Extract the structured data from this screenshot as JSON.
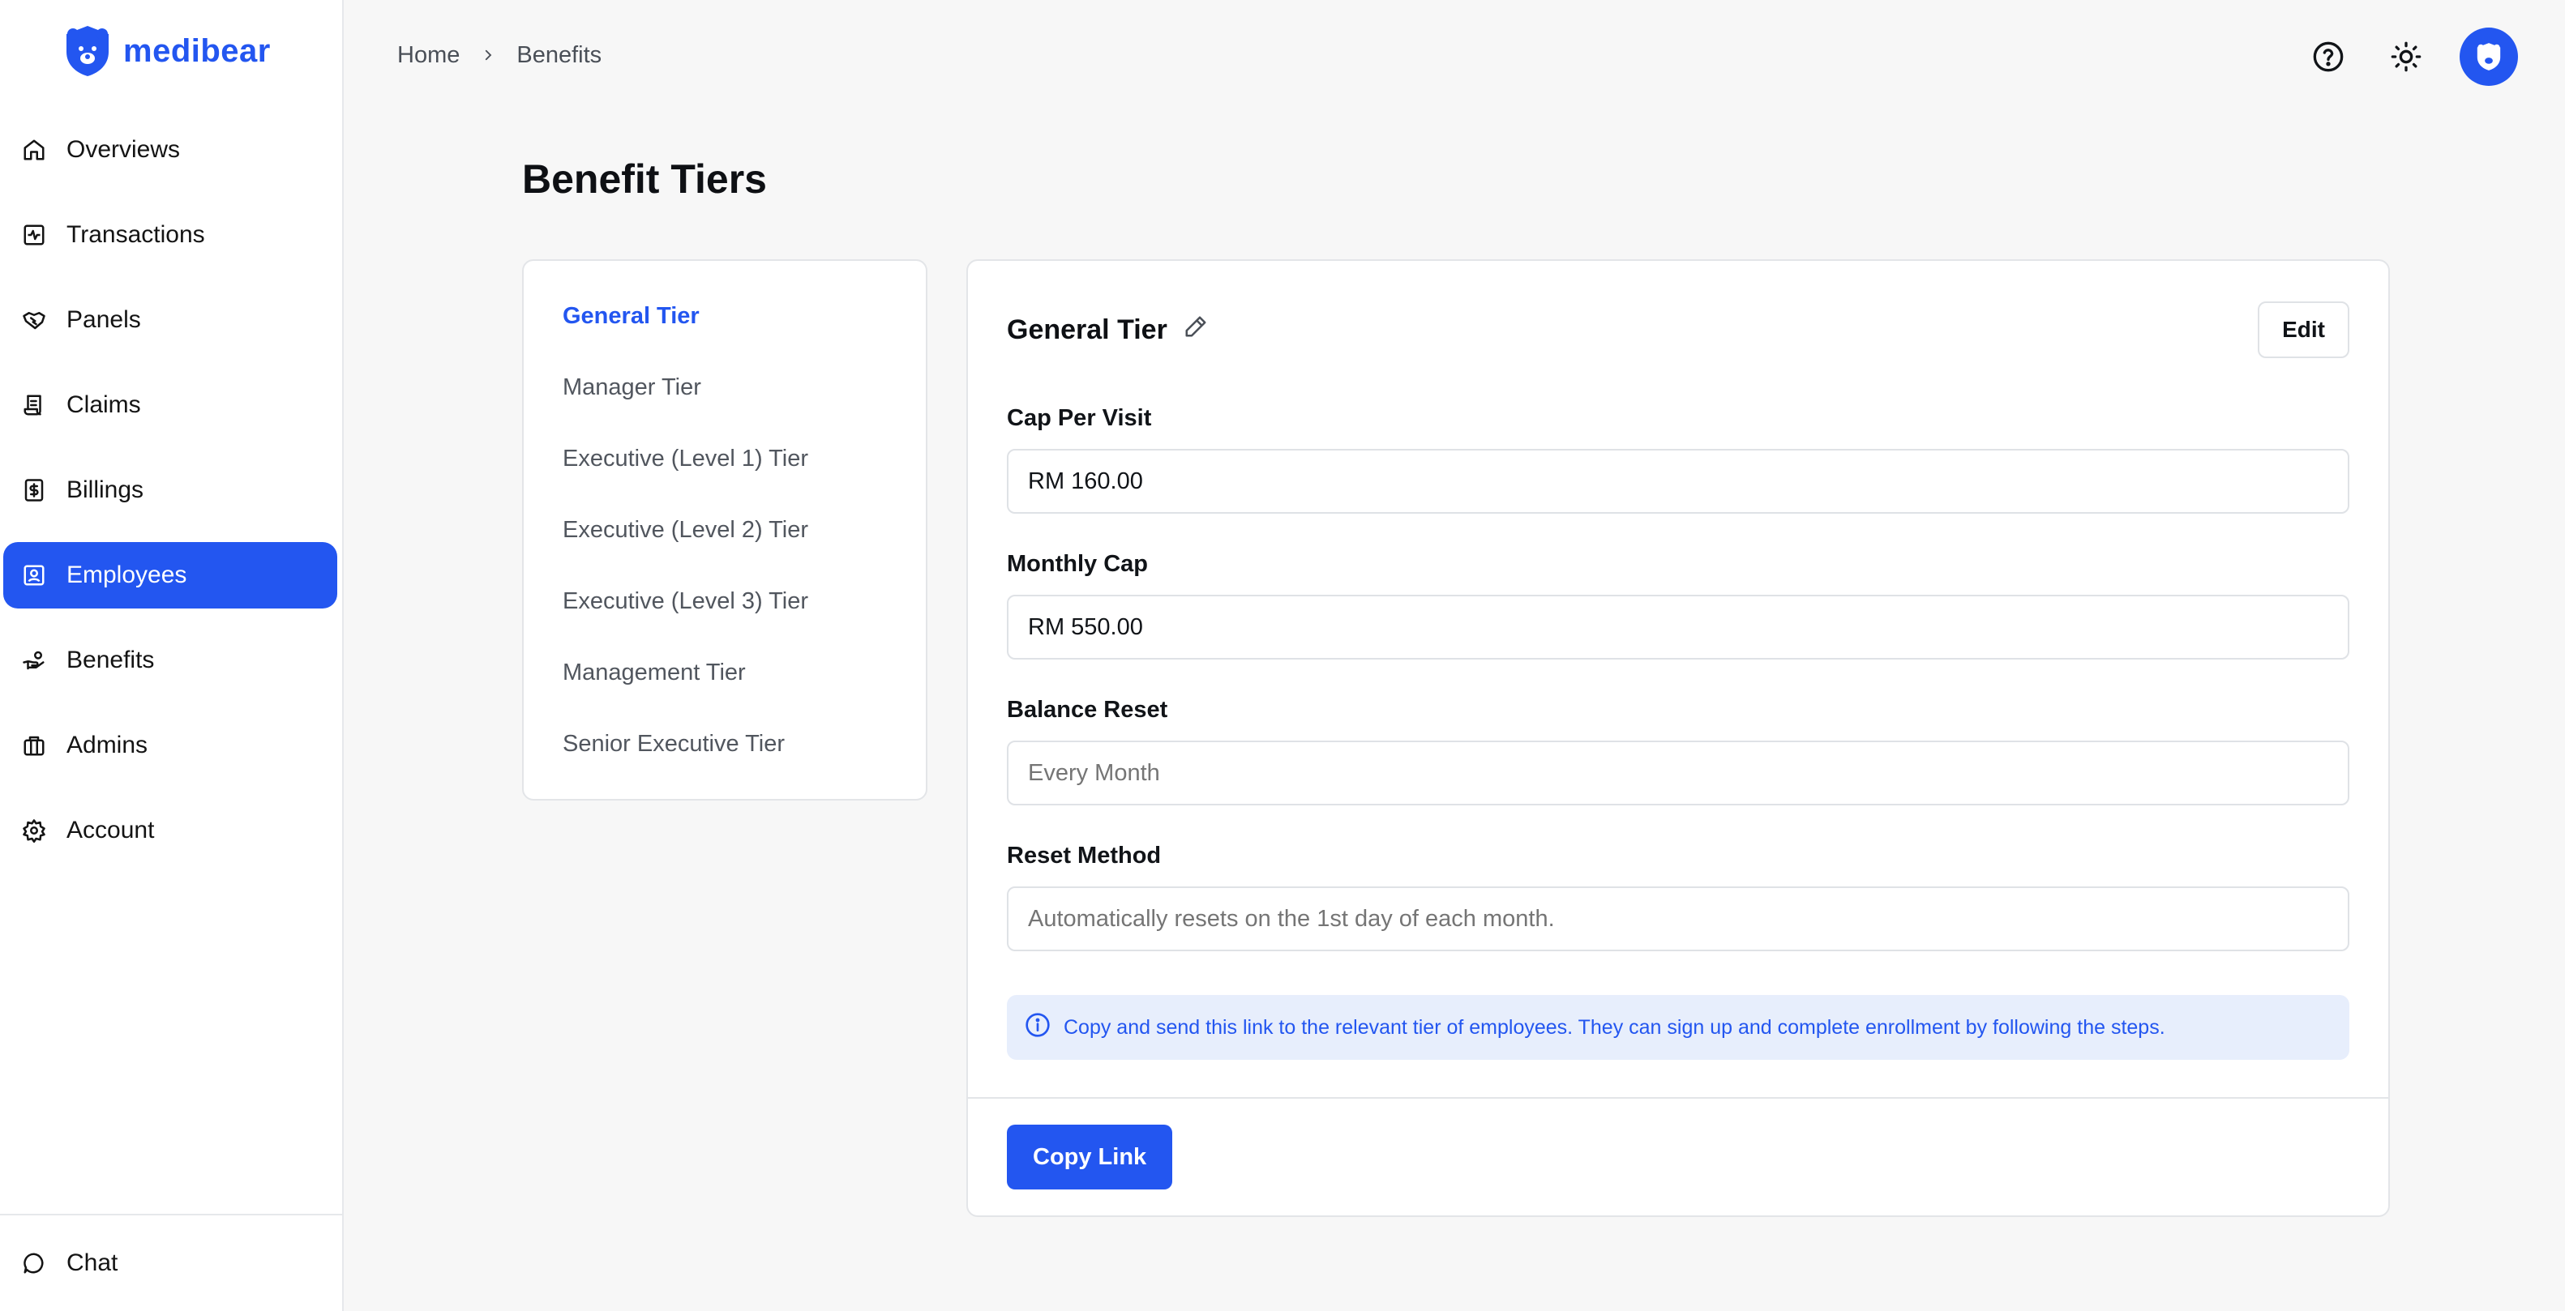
{
  "brand": {
    "name": "medibear",
    "color": "#2356f0"
  },
  "sidebar": {
    "items": [
      {
        "label": "Overviews",
        "icon": "home-icon"
      },
      {
        "label": "Transactions",
        "icon": "activity-icon"
      },
      {
        "label": "Panels",
        "icon": "handshake-icon"
      },
      {
        "label": "Claims",
        "icon": "scroll-icon"
      },
      {
        "label": "Billings",
        "icon": "dollar-receipt-icon"
      },
      {
        "label": "Employees",
        "icon": "contact-badge-icon",
        "active": true
      },
      {
        "label": "Benefits",
        "icon": "hand-coins-icon"
      },
      {
        "label": "Admins",
        "icon": "briefcase-icon"
      },
      {
        "label": "Account",
        "icon": "gear-icon"
      }
    ],
    "bottom": {
      "label": "Chat",
      "icon": "chat-bubble-icon"
    }
  },
  "breadcrumb": {
    "items": [
      "Home",
      "Benefits"
    ]
  },
  "header": {
    "icons": [
      "help-circle-icon",
      "sun-icon",
      "avatar-bear-icon"
    ]
  },
  "page": {
    "title": "Benefit Tiers"
  },
  "tiers": {
    "items": [
      "General Tier",
      "Manager Tier",
      "Executive (Level 1) Tier",
      "Executive (Level 2) Tier",
      "Executive (Level 3) Tier",
      "Management Tier",
      "Senior Executive Tier"
    ],
    "active_index": 0
  },
  "detail": {
    "title": "General Tier",
    "edit_label": "Edit",
    "fields": {
      "cap_per_visit": {
        "label": "Cap Per Visit",
        "value": "RM 160.00"
      },
      "monthly_cap": {
        "label": "Monthly Cap",
        "value": "RM 550.00"
      },
      "balance_reset": {
        "label": "Balance Reset",
        "placeholder": "Every Month"
      },
      "reset_method": {
        "label": "Reset Method",
        "placeholder": "Automatically resets on the 1st day of each month."
      }
    },
    "info": "Copy and send this link to the relevant tier of employees. They can sign up and complete enrollment by following the steps.",
    "copy_label": "Copy Link"
  }
}
